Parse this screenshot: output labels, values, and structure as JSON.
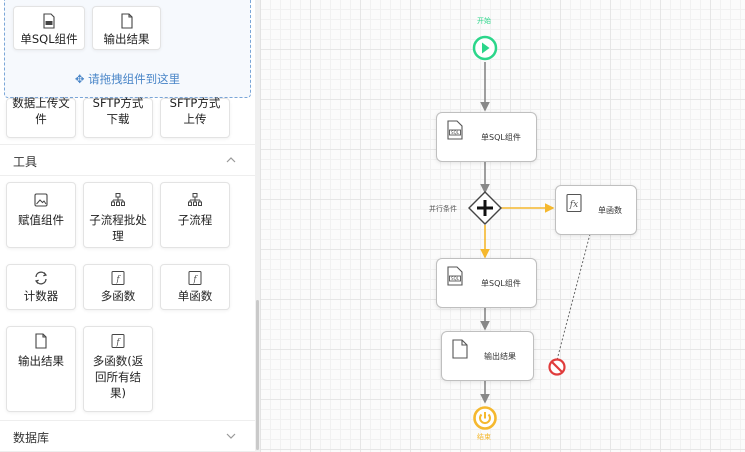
{
  "palette": {
    "drop_zone_cards": [
      {
        "label": "单SQL组件",
        "icon": "sql-file-icon"
      },
      {
        "label": "输出结果",
        "icon": "file-icon"
      }
    ],
    "drop_hint": "✥ 请拖拽组件到这里",
    "partial_cards": [
      {
        "line1": "数据上传文",
        "line2": "件"
      },
      {
        "line1": "SFTP方式",
        "line2": "下载"
      },
      {
        "line1": "SFTP方式",
        "line2": "上传"
      }
    ],
    "tools_section": {
      "title": "工具",
      "cards": [
        {
          "label": "赋值组件",
          "icon": "image-icon"
        },
        {
          "label_lines": [
            "子流程批处",
            "理"
          ],
          "icon": "hierarchy-icon"
        },
        {
          "label": "子流程",
          "icon": "hierarchy-icon"
        },
        {
          "label": "计数器",
          "icon": "refresh-icon"
        },
        {
          "label": "多函数",
          "icon": "function-icon"
        },
        {
          "label": "单函数",
          "icon": "function-icon"
        },
        {
          "label": "输出结果",
          "icon": "file-icon"
        },
        {
          "label_lines": [
            "多函数(返",
            "回所有结",
            "果)"
          ],
          "icon": "function-icon"
        }
      ]
    },
    "database_section": {
      "title": "数据库"
    }
  },
  "flow": {
    "start_label": "开始",
    "end_label": "结束",
    "gateway_label": "并行条件",
    "nodes": [
      {
        "label": "单SQL组件",
        "icon": "sql-file-icon"
      },
      {
        "label": "单函数",
        "icon": "function-icon"
      },
      {
        "label": "单SQL组件",
        "icon": "sql-file-icon"
      },
      {
        "label": "输出结果",
        "icon": "file-icon"
      }
    ]
  },
  "colors": {
    "start_green": "#2bd68a",
    "end_orange": "#f5b82e",
    "edge_gray": "#888888",
    "edge_orange": "#f5b82e",
    "blocked_red": "#e03c3c",
    "accent_blue": "#4a86c8"
  }
}
